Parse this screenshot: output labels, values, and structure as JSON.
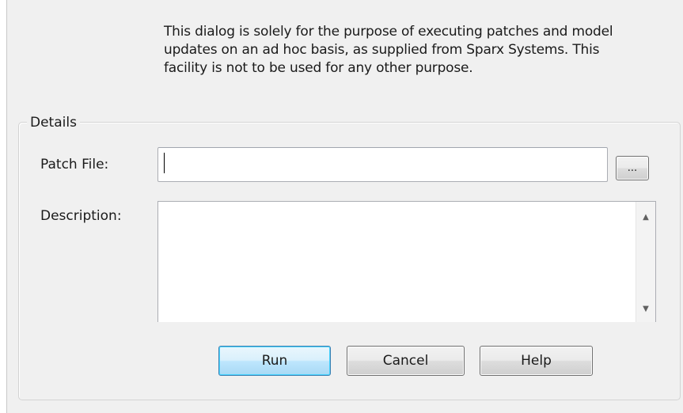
{
  "intro_text": "This dialog is solely for the purpose of executing patches and model\nupdates on an ad hoc basis, as supplied from Sparx Systems. This\nfacility is not to be used for any other purpose.",
  "details": {
    "legend": "Details",
    "patch_file": {
      "label": "Patch File:",
      "value": "",
      "browse_label": "..."
    },
    "description": {
      "label": "Description:",
      "value": ""
    }
  },
  "buttons": {
    "run": "Run",
    "cancel": "Cancel",
    "help": "Help"
  },
  "icons": {
    "scroll_up": "scroll-up-arrow-icon",
    "scroll_down": "scroll-down-arrow-icon"
  },
  "colors": {
    "dialog_bg": "#f0f0f0",
    "default_button_border": "#3c7fb1",
    "default_button_fill": "#bee6fd"
  }
}
